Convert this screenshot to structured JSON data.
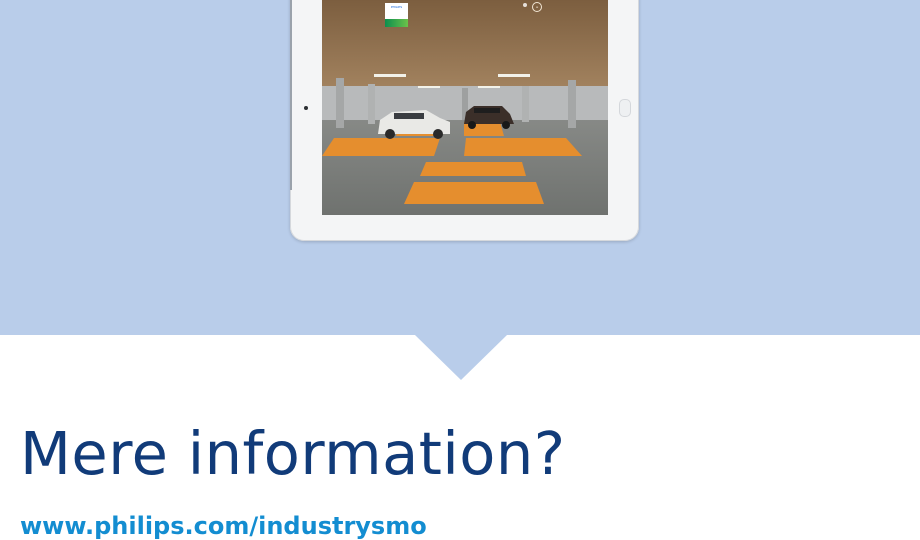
{
  "hero": {
    "background_color": "#b9cdea"
  },
  "tablet_screen": {
    "scene": "parking garage with orange marked parking bays and two cars",
    "top_bar": {
      "left_label": "",
      "center_label": ""
    },
    "brand_logo_text": "PHILIPS"
  },
  "info": {
    "heading": "Mere information?",
    "url": "www.philips.com/industrysmo",
    "heading_color": "#113b79",
    "link_color": "#138dd1"
  }
}
